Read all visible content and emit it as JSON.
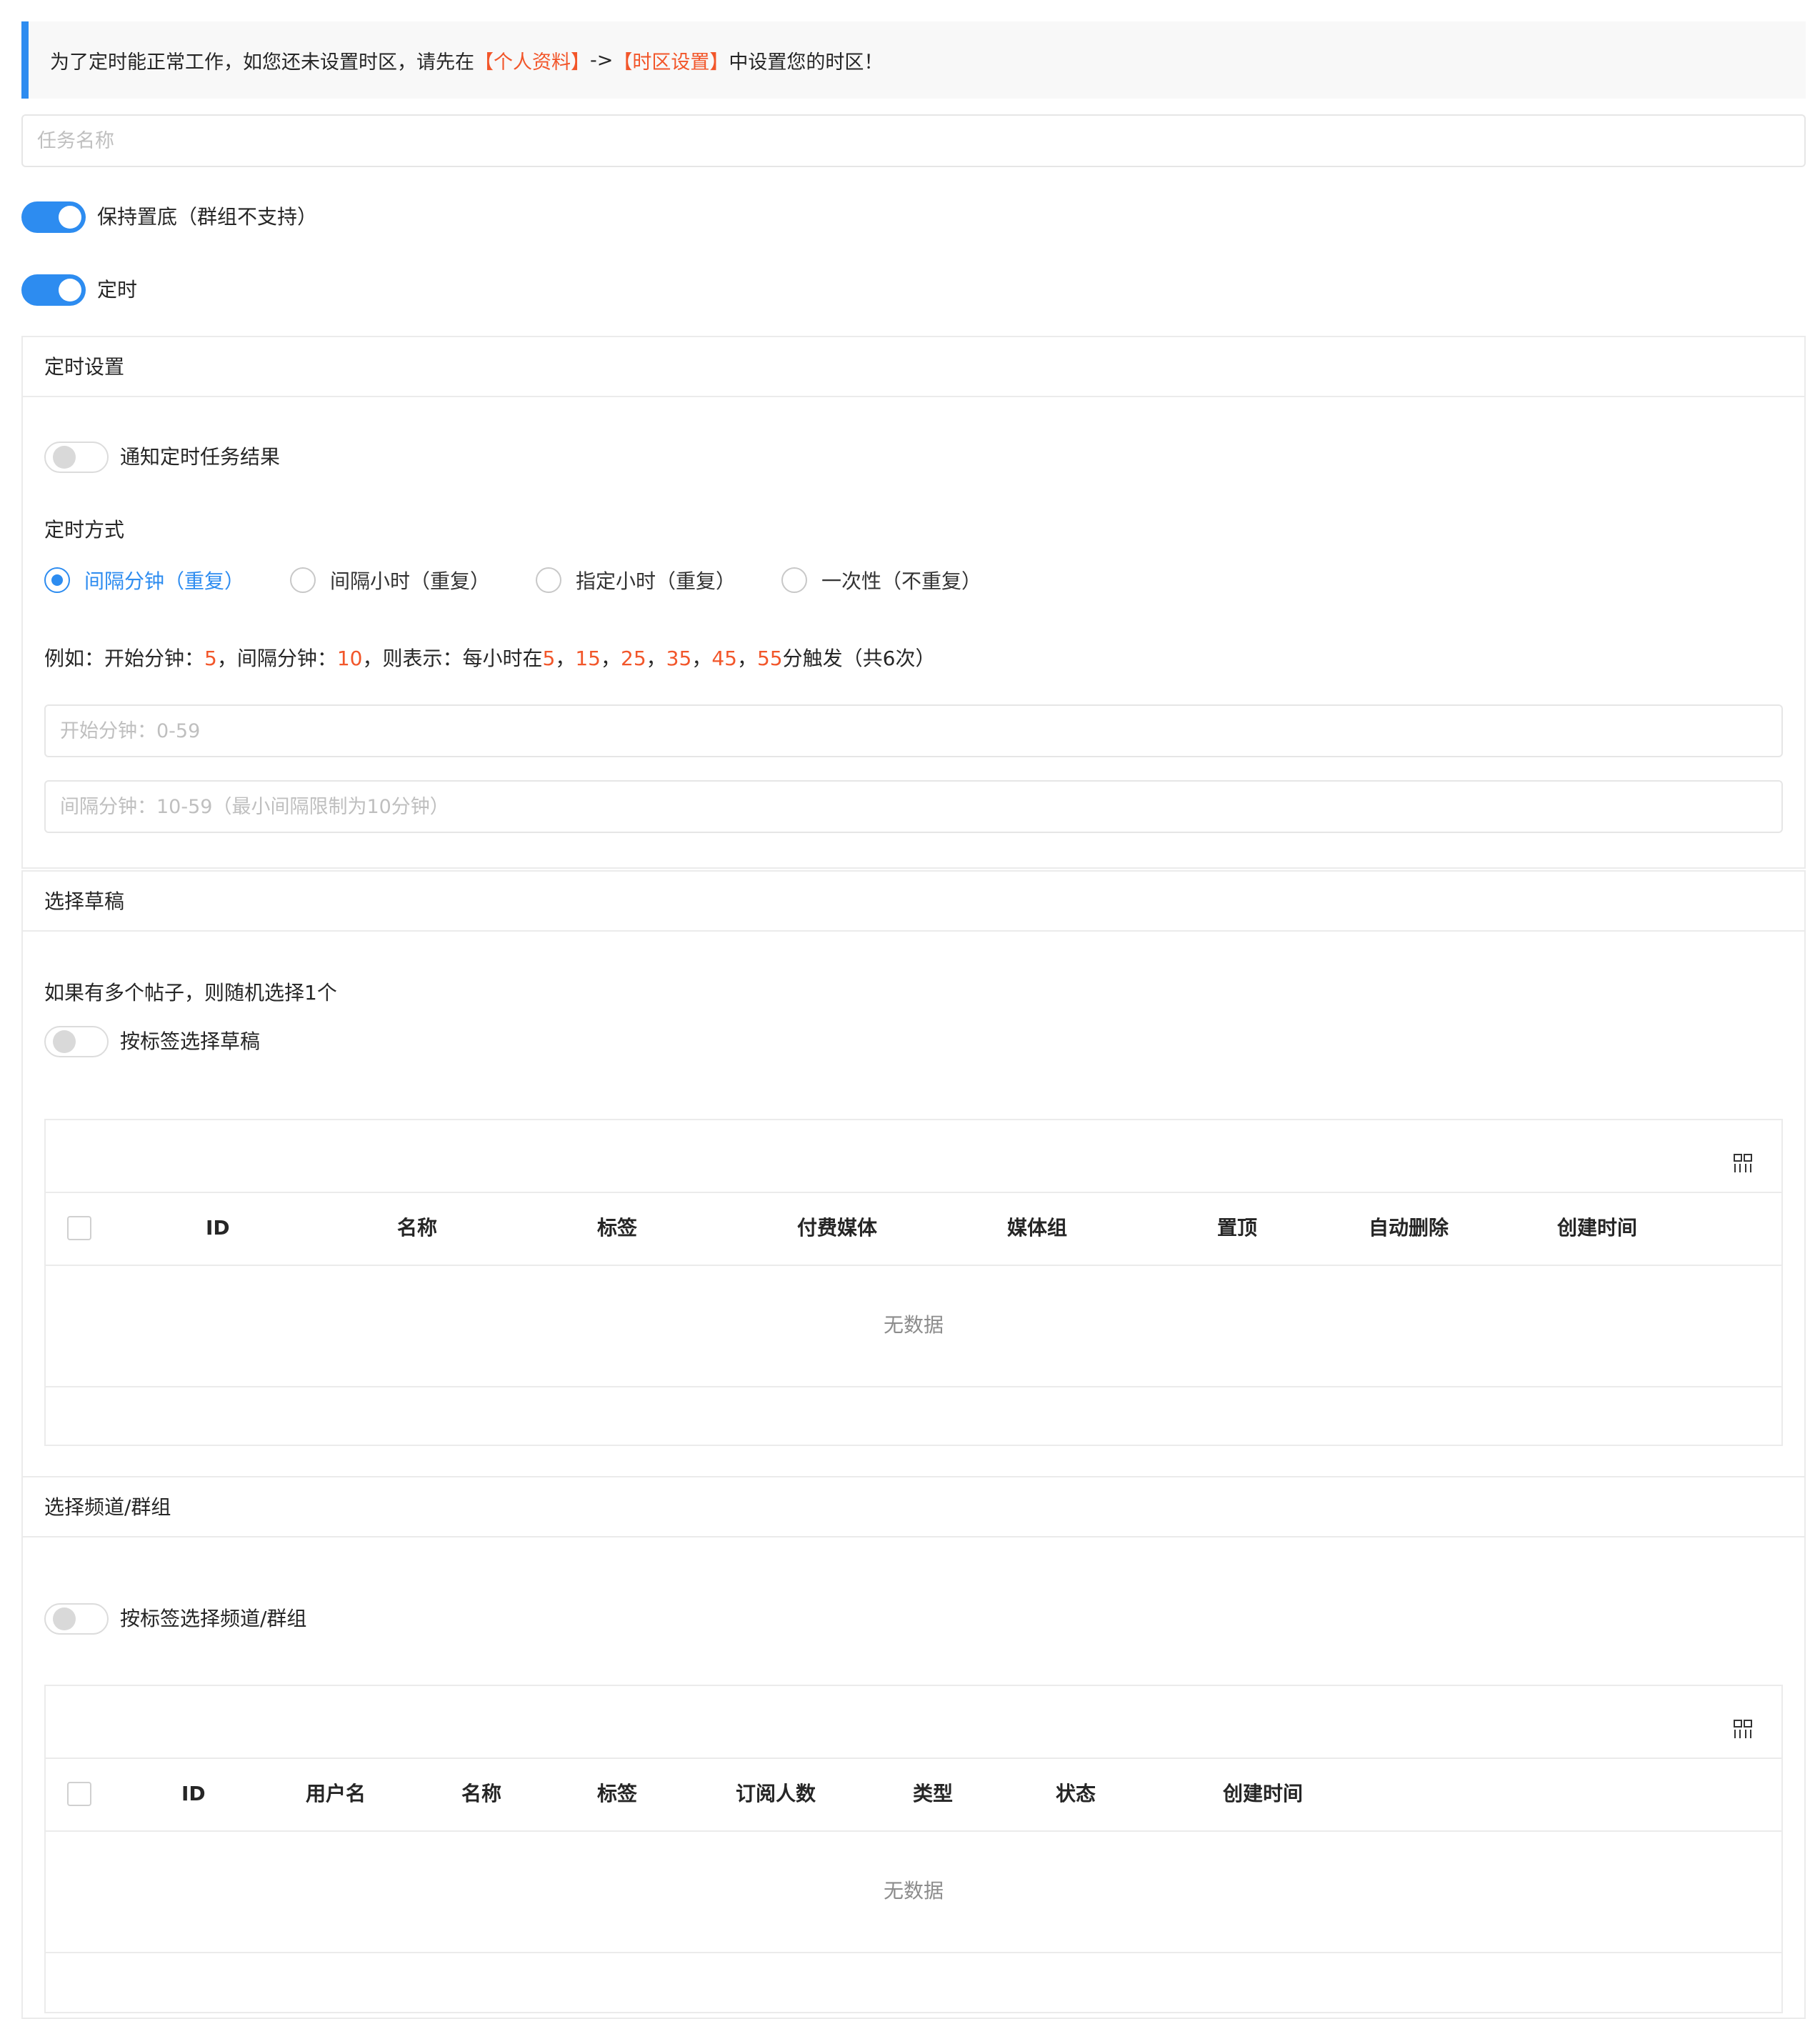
{
  "notice": {
    "prefix": "为了定时能正常工作，如您还未设置时区，请先在",
    "link1": "【个人资料】",
    "arrow": "->",
    "link2": "【时区设置】",
    "suffix": "中设置您的时区！",
    "accent_color": "#f2562a",
    "bar_color": "#2d8cf0"
  },
  "task_name": {
    "placeholder": "任务名称",
    "value": ""
  },
  "keep_bottom": {
    "label": "保持置底（群组不支持）",
    "on": true
  },
  "schedule_toggle": {
    "label": "定时",
    "on": true
  },
  "schedule_panel": {
    "title": "定时设置",
    "notify": {
      "label": "通知定时任务结果",
      "on": false
    },
    "mode_label": "定时方式",
    "modes": [
      {
        "label": "间隔分钟（重复）",
        "selected": true
      },
      {
        "label": "间隔小时（重复）",
        "selected": false
      },
      {
        "label": "指定小时（重复）",
        "selected": false
      },
      {
        "label": "一次性（不重复）",
        "selected": false
      }
    ],
    "example": {
      "p1": "例如：开始分钟：",
      "n1": "5",
      "p2": "，间隔分钟：",
      "n2": "10",
      "p3": "，则表示：每小时在",
      "m1": "5",
      "s1": "，",
      "m2": "15",
      "s2": "，",
      "m3": "25",
      "s3": "，",
      "m4": "35",
      "s4": "，",
      "m5": "45",
      "s5": "，",
      "m6": "55",
      "p4": "分触发（共6次）"
    },
    "start_minute": {
      "placeholder": "开始分钟：0-59",
      "value": ""
    },
    "interval_minute": {
      "placeholder": "间隔分钟：10-59（最小间隔限制为10分钟）",
      "value": ""
    }
  },
  "draft_panel": {
    "title": "选择草稿",
    "hint": "如果有多个帖子，则随机选择1个",
    "by_tag": {
      "label": "按标签选择草稿",
      "on": false
    },
    "columns": [
      "ID",
      "名称",
      "标签",
      "付费媒体",
      "媒体组",
      "置顶",
      "自动删除",
      "创建时间"
    ],
    "empty_text": "无数据"
  },
  "channel_panel": {
    "title": "选择频道/群组",
    "by_tag": {
      "label": "按标签选择频道/群组",
      "on": false
    },
    "columns": [
      "ID",
      "用户名",
      "名称",
      "标签",
      "订阅人数",
      "类型",
      "状态",
      "创建时间"
    ],
    "empty_text": "无数据"
  },
  "icons": {
    "column_settings": "column-settings-icon"
  }
}
